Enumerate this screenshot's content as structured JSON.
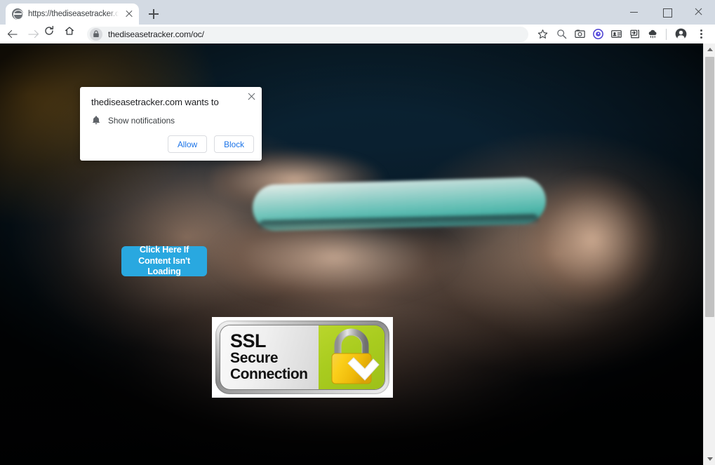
{
  "browser": {
    "tab": {
      "title": "https://thediseasetracker.com/oc",
      "favicon": "globe-icon",
      "close_label": "x"
    },
    "new_tab_label": "+",
    "window_controls": {
      "minimize": "minimize-icon",
      "maximize": "maximize-icon",
      "close": "close-icon"
    },
    "toolbar": {
      "back": "back-arrow-icon",
      "forward": "forward-arrow-icon",
      "reload": "reload-icon",
      "home": "home-icon",
      "security_icon": "lock-icon",
      "url": "thediseasetracker.com/oc/",
      "bookmark": "star-icon",
      "extensions": [
        "magnifier-icon",
        "screenshot-camera-icon",
        "blue-circle-extension-icon",
        "id-card-icon",
        "share-arrow-icon",
        "weather-cloud-icon"
      ],
      "profile": "account-avatar-icon",
      "menu": "three-dot-menu-icon"
    }
  },
  "permission_prompt": {
    "title": "thediseasetracker.com wants to",
    "request_icon": "bell-icon",
    "request_label": "Show notifications",
    "allow_label": "Allow",
    "block_label": "Block",
    "close_label": "close-icon"
  },
  "page": {
    "cta_button": {
      "line1": "Click Here If",
      "line2": "Content Isn't",
      "line3": "Loading",
      "text": "Click Here If Content Isn't Loading",
      "color": "#29a8e0",
      "text_color": "#ffffff"
    },
    "ssl_badge": {
      "line1": "SSL",
      "line2": "Secure",
      "line3": "Connection",
      "icon": "padlock-check-icon",
      "panel_color": "#a9cc1f",
      "lock_color": "#f5c211",
      "frame_color": "#8d8d8d"
    },
    "background": {
      "description": "hands-holding-phone-photo",
      "accent": "#0b2433"
    }
  },
  "scrollbar": {
    "up_arrow": "scroll-up-icon",
    "down_arrow": "scroll-down-icon",
    "thumb": "scroll-thumb"
  }
}
